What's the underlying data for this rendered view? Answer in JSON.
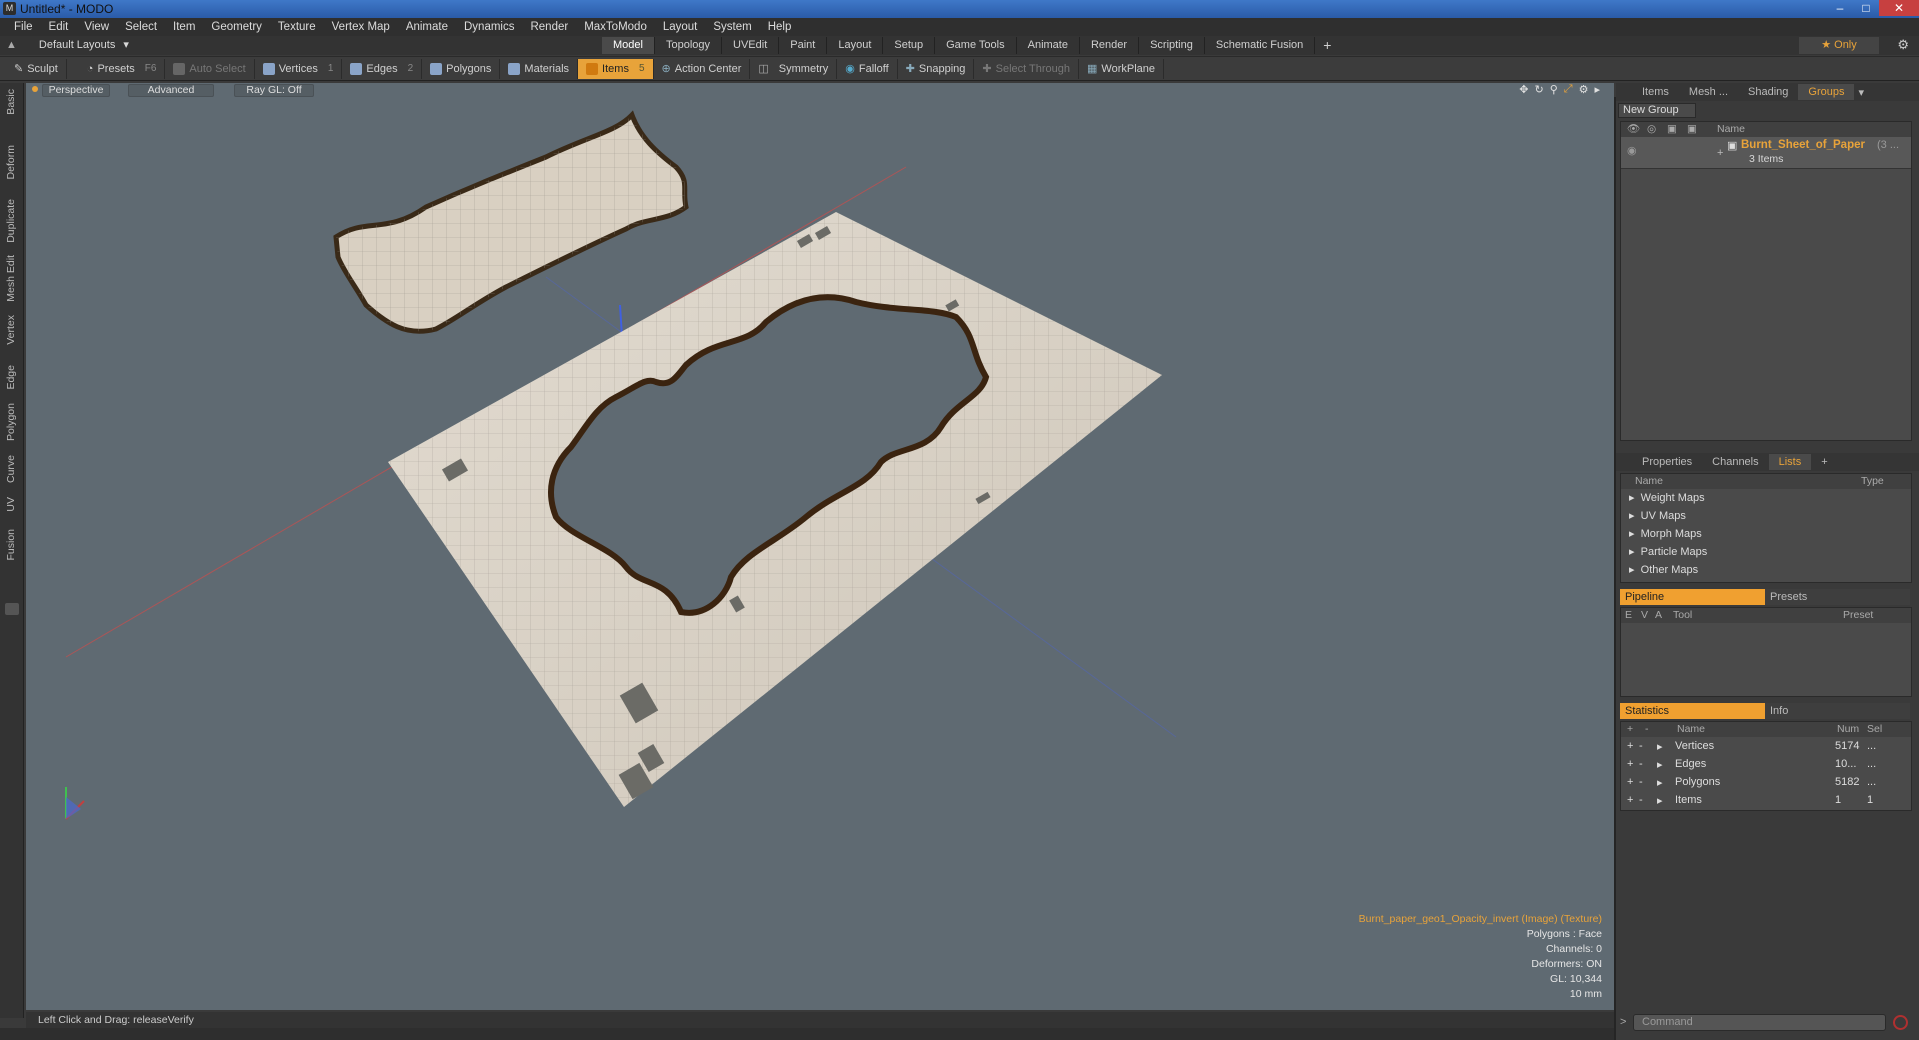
{
  "window": {
    "title": "Untitled* - MODO",
    "app_icon": "M"
  },
  "menubar": [
    "File",
    "Edit",
    "View",
    "Select",
    "Item",
    "Geometry",
    "Texture",
    "Vertex Map",
    "Animate",
    "Dynamics",
    "Render",
    "MaxToModo",
    "Layout",
    "System",
    "Help"
  ],
  "layoutbar": {
    "layouts_label": "Default Layouts",
    "tabs": [
      "Model",
      "Topology",
      "UVEdit",
      "Paint",
      "Layout",
      "Setup",
      "Game Tools",
      "Animate",
      "Render",
      "Scripting",
      "Schematic Fusion"
    ],
    "active_tab": "Model",
    "add": "+",
    "only_label": "★ Only"
  },
  "toolbar": {
    "sculpt": "Sculpt",
    "presets": "Presets",
    "presets_key": "F6",
    "auto_select": "Auto Select",
    "vertices": "Vertices",
    "vertices_key": "1",
    "edges": "Edges",
    "edges_key": "2",
    "polygons": "Polygons",
    "materials": "Materials",
    "items": "Items",
    "items_key": "5",
    "action_center": "Action Center",
    "symmetry": "Symmetry",
    "falloff": "Falloff",
    "snapping": "Snapping",
    "select_through": "Select Through",
    "workplane": "WorkPlane"
  },
  "left_tabs": [
    "Basic",
    "Deform",
    "Duplicate",
    "Mesh Edit",
    "Vertex",
    "Edge",
    "Polygon",
    "Curve",
    "UV",
    "Fusion"
  ],
  "viewport": {
    "view_mode": "Perspective",
    "shading": "Advanced",
    "raygl": "Ray GL: Off",
    "info": {
      "texture": "Burnt_paper_geo1_Opacity_invert (Image) (Texture)",
      "polygons": "Polygons : Face",
      "channels": "Channels: 0",
      "deformers": "Deformers: ON",
      "gl": "GL: 10,344",
      "scale": "10 mm"
    },
    "axis_labels": {
      "x": "X",
      "y": "Y",
      "z": "Z"
    }
  },
  "statusbar": {
    "text": "Left Click and Drag:  releaseVerify"
  },
  "right_top": {
    "tabs": [
      "Items",
      "Mesh ...",
      "Shading",
      "Groups"
    ],
    "active_tab": "Groups",
    "new_group": "New Group",
    "name_header": "Name",
    "group_name": "Burnt_Sheet_of_Paper",
    "group_suffix": "(3 ...",
    "group_count": "3 Items"
  },
  "right_mid": {
    "tabs": [
      "Properties",
      "Channels",
      "Lists"
    ],
    "active_tab": "Lists",
    "add": "+",
    "col_name": "Name",
    "col_type": "Type",
    "maps": [
      "Weight Maps",
      "UV Maps",
      "Morph Maps",
      "Particle Maps",
      "Other Maps"
    ]
  },
  "pipeline": {
    "tabs": [
      "Pipeline",
      "Presets"
    ],
    "cols": [
      "E",
      "V",
      "A",
      "Tool",
      "Preset"
    ]
  },
  "statistics": {
    "tabs": [
      "Statistics",
      "Info"
    ],
    "cols": [
      "Name",
      "Num",
      "Sel"
    ],
    "rows": [
      {
        "name": "Vertices",
        "num": "5174",
        "sel": "..."
      },
      {
        "name": "Edges",
        "num": "10...",
        "sel": "..."
      },
      {
        "name": "Polygons",
        "num": "5182",
        "sel": "..."
      },
      {
        "name": "Items",
        "num": "1",
        "sel": "1"
      }
    ]
  },
  "command": {
    "placeholder": "Command"
  },
  "colors": {
    "accent": "#e8a33a",
    "viewport_bg": "#5f6a72",
    "paper": "#d8d0c4"
  }
}
